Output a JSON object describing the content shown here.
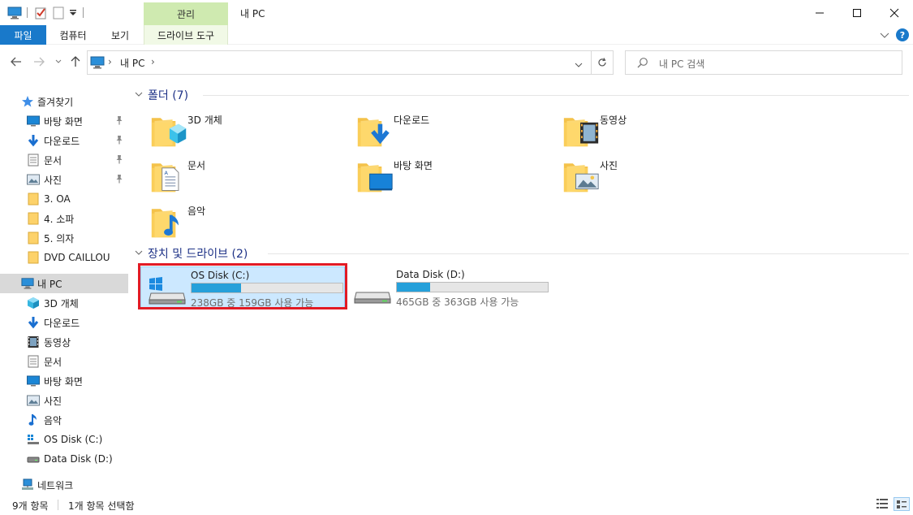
{
  "window": {
    "title": "내 PC",
    "contextual_tab": "관리",
    "controls": {
      "minimize": "—",
      "maximize": "☐",
      "close": "✕"
    }
  },
  "ribbon": {
    "tabs": {
      "file": "파일",
      "computer": "컴퓨터",
      "view": "보기",
      "drive_tools": "드라이브 도구"
    },
    "help": "?"
  },
  "address": {
    "path": [
      "내 PC"
    ],
    "separator": "›",
    "search_placeholder": "내 PC 검색"
  },
  "nav": {
    "quick_access": "즐겨찾기",
    "quick_items": [
      {
        "label": "바탕 화면",
        "icon": "desktop-icon",
        "pinned": true
      },
      {
        "label": "다운로드",
        "icon": "download-icon",
        "pinned": true
      },
      {
        "label": "문서",
        "icon": "document-icon",
        "pinned": true
      },
      {
        "label": "사진",
        "icon": "pictures-icon",
        "pinned": true
      },
      {
        "label": "3. OA",
        "icon": "folder-icon",
        "pinned": false
      },
      {
        "label": "4. 소파",
        "icon": "folder-icon",
        "pinned": false
      },
      {
        "label": "5. 의자",
        "icon": "folder-icon",
        "pinned": false
      },
      {
        "label": "DVD CAILLOU",
        "icon": "folder-icon",
        "pinned": false
      }
    ],
    "this_pc": "내 PC",
    "pc_items": [
      {
        "label": "3D 개체",
        "icon": "3d-objects-icon"
      },
      {
        "label": "다운로드",
        "icon": "download-icon"
      },
      {
        "label": "동영상",
        "icon": "video-icon"
      },
      {
        "label": "문서",
        "icon": "document-icon"
      },
      {
        "label": "바탕 화면",
        "icon": "desktop-icon"
      },
      {
        "label": "사진",
        "icon": "pictures-icon"
      },
      {
        "label": "음악",
        "icon": "music-icon"
      },
      {
        "label": "OS Disk (C:)",
        "icon": "windows-drive-icon"
      },
      {
        "label": "Data Disk (D:)",
        "icon": "drive-icon"
      }
    ],
    "network": "네트워크"
  },
  "content": {
    "folders_header": "폴더 (7)",
    "folders": [
      {
        "name": "3D 개체",
        "icon": "3d-objects-icon"
      },
      {
        "name": "다운로드",
        "icon": "download-icon"
      },
      {
        "name": "동영상",
        "icon": "video-icon"
      },
      {
        "name": "문서",
        "icon": "document-icon"
      },
      {
        "name": "바탕 화면",
        "icon": "desktop-icon"
      },
      {
        "name": "사진",
        "icon": "pictures-icon"
      },
      {
        "name": "음악",
        "icon": "music-icon"
      }
    ],
    "drives_header": "장치 및 드라이브 (2)",
    "drives": [
      {
        "name": "OS Disk (C:)",
        "info": "238GB 중 159GB 사용 가능",
        "used_fraction": 0.33,
        "selected": true,
        "highlighted": true,
        "icon": "windows-drive-icon"
      },
      {
        "name": "Data Disk (D:)",
        "info": "465GB 중 363GB 사용 가능",
        "used_fraction": 0.22,
        "selected": false,
        "highlighted": false,
        "icon": "drive-icon"
      }
    ]
  },
  "status": {
    "items_count": "9개 항목",
    "selected_count": "1개 항목 선택함"
  },
  "colors": {
    "file_tab": "#1979ca",
    "manage_tab": "#cfeab0",
    "selection": "#cce8ff",
    "progress": "#26a0da",
    "highlight_box": "#e21b25",
    "group_title": "#1e3287"
  }
}
